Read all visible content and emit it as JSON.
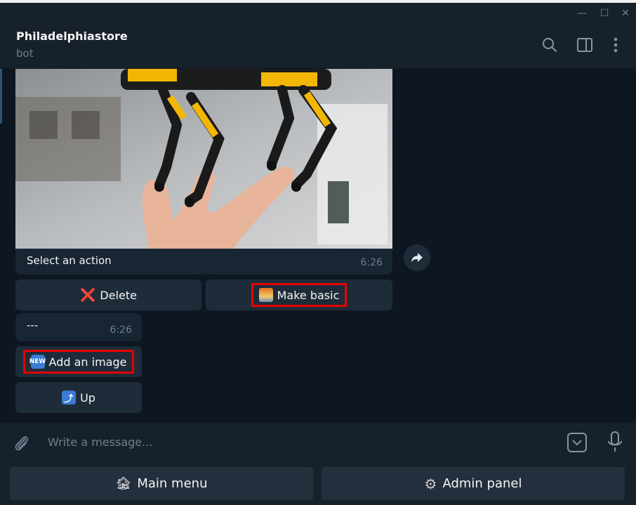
{
  "window": {
    "minimize": "—",
    "maximize": "☐",
    "close": "✕"
  },
  "header": {
    "title": "Philadelphiastore",
    "subtitle": "bot"
  },
  "message": {
    "caption": "Select an action",
    "time": "6:26",
    "image_description_icon": "robot-dog-photo"
  },
  "inline_keyboard": {
    "delete_label": "Delete",
    "delete_emoji": "❌",
    "make_basic_label": "Make basic",
    "make_basic_emoji": "🌅"
  },
  "second_message": {
    "text": "---",
    "time": "6:26"
  },
  "second_keyboard": {
    "add_image_label": "Add an image",
    "add_image_badge": "NEW",
    "up_label": "Up",
    "up_emoji": "⤴"
  },
  "input": {
    "placeholder": "Write a message..."
  },
  "reply_keyboard": {
    "main_menu_label": "Main menu",
    "main_menu_emoji": "🏚",
    "admin_panel_label": "Admin panel",
    "admin_panel_emoji": "⚙"
  },
  "colors": {
    "accent": "#2b5278",
    "highlight": "#e60000",
    "bg": "#0e1621",
    "panel": "#17212b"
  }
}
